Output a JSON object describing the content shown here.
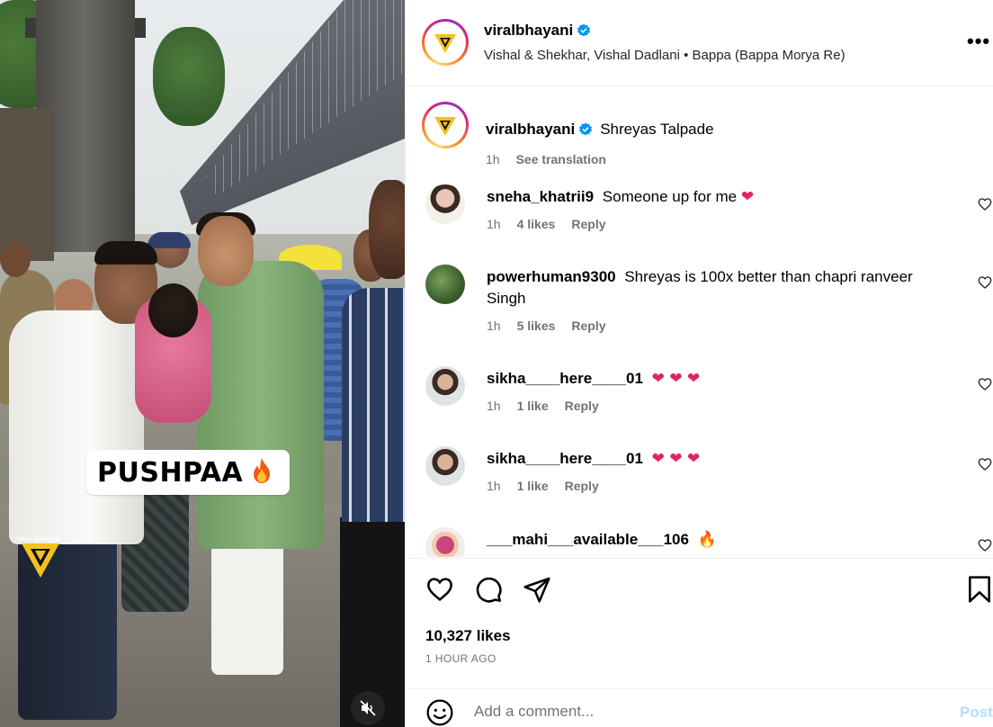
{
  "media": {
    "caption_overlay": "PUSHPAA",
    "caption_emoji": "🔥",
    "watermark": "VIRAL BHAYANI"
  },
  "header": {
    "username": "viralbhayani",
    "subtitle": "Vishal & Shekhar, Vishal Dadlani • Bappa (Bappa Morya Re)",
    "more": "•••"
  },
  "caption": {
    "username": "viralbhayani",
    "text": "Shreyas Talpade",
    "time": "1h",
    "see_translation": "See translation"
  },
  "comments": [
    {
      "username": "sneha_khatrii9",
      "text": "Someone up for me",
      "emoji": "❤",
      "time": "1h",
      "likes": "4 likes",
      "reply": "Reply"
    },
    {
      "username": "powerhuman9300",
      "text": "Shreyas is 100x better than chapri ranveer Singh",
      "emoji": "",
      "time": "1h",
      "likes": "5 likes",
      "reply": "Reply"
    },
    {
      "username": "sikha____here____01",
      "text": "",
      "emoji": "❤ ❤ ❤",
      "time": "1h",
      "likes": "1 like",
      "reply": "Reply"
    },
    {
      "username": "sikha____here____01",
      "text": "",
      "emoji": "❤ ❤ ❤",
      "time": "1h",
      "likes": "1 like",
      "reply": "Reply"
    },
    {
      "username": "___mahi___available___106",
      "text": "",
      "emoji": "🔥",
      "time": "",
      "likes": "",
      "reply": ""
    }
  ],
  "footer": {
    "likes": "10,327 likes",
    "time_ago": "1 HOUR AGO",
    "comment_placeholder": "Add a comment...",
    "post_label": "Post"
  },
  "colors": {
    "text_primary": "#000000",
    "text_secondary": "#737373",
    "verified_blue": "#0095f6",
    "post_disabled": "#b2dffc",
    "heart_red": "#e0245e"
  }
}
